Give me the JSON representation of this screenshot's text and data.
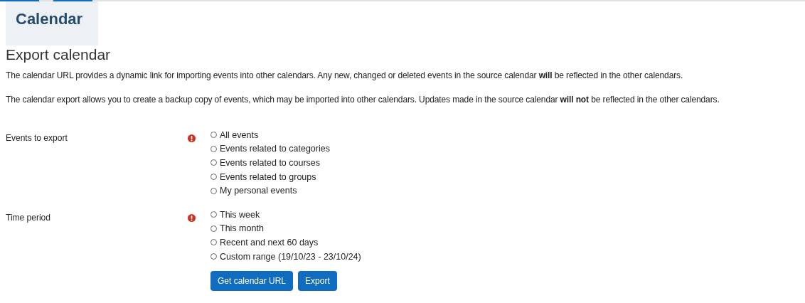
{
  "page_title": "Calendar",
  "heading": "Export calendar",
  "paragraphs": [
    "The calendar URL provides a dynamic link for importing events into other calendars. Any new, changed or deleted events in the source calendar **will** be reflected in the other calendars.",
    "The calendar export allows you to create a backup copy of events, which may be imported into other calendars. Updates made in the source calendar **will not** be reflected in the other calendars."
  ],
  "groups": [
    {
      "label": "Events to export",
      "required": true,
      "options": [
        {
          "label": "All events",
          "selected": false
        },
        {
          "label": "Events related to categories",
          "selected": false
        },
        {
          "label": "Events related to courses",
          "selected": false
        },
        {
          "label": "Events related to groups",
          "selected": false
        },
        {
          "label": "My personal events",
          "selected": false
        }
      ]
    },
    {
      "label": "Time period",
      "required": true,
      "options": [
        {
          "label": "This week",
          "selected": false
        },
        {
          "label": "This month",
          "selected": false
        },
        {
          "label": "Recent and next 60 days",
          "selected": false
        },
        {
          "label": "Custom range (19/10/23 - 23/10/24)",
          "selected": false
        }
      ]
    }
  ],
  "buttons": [
    "Get calendar URL",
    "Export"
  ]
}
